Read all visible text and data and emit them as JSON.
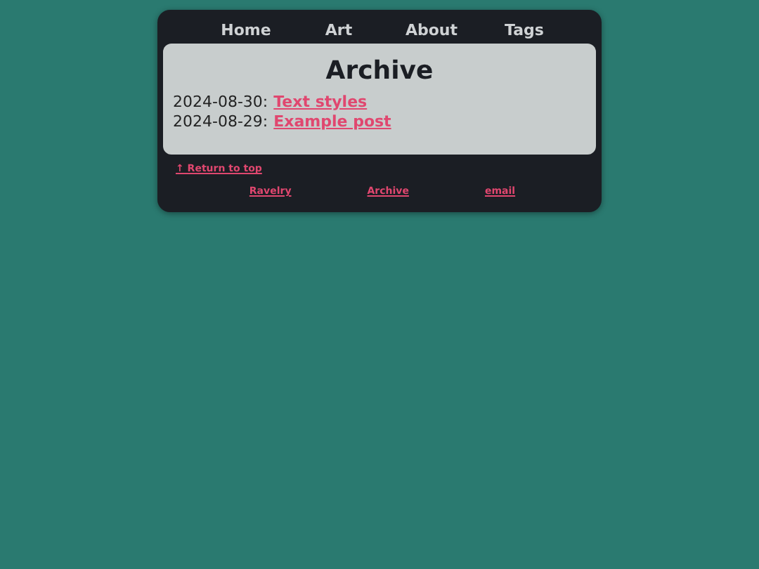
{
  "nav": [
    {
      "label": "Home"
    },
    {
      "label": "Art"
    },
    {
      "label": "About"
    },
    {
      "label": "Tags"
    }
  ],
  "archive": {
    "title": "Archive",
    "entries": [
      {
        "date": "2024-08-30:",
        "title": "Text styles"
      },
      {
        "date": "2024-08-29:",
        "title": "Example post"
      }
    ]
  },
  "footer": {
    "return_link": "↑ Return to top",
    "links": [
      {
        "label": "Ravelry"
      },
      {
        "label": "Archive"
      },
      {
        "label": "email"
      }
    ]
  }
}
